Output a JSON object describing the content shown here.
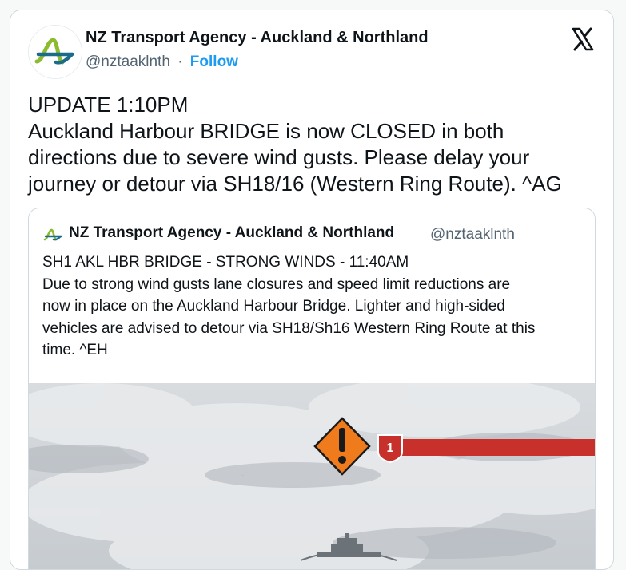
{
  "author": {
    "name": "NZ Transport Agency - Auckland & Northland",
    "handle": "@nztaaklnth",
    "separator": "·",
    "follow_label": "Follow",
    "avatar_icon": "nzta-logo-icon"
  },
  "platform_icon": "x-logo-icon",
  "tweet": {
    "lines": [
      "UPDATE 1:10PM",
      "Auckland Harbour BRIDGE is now CLOSED in both",
      "directions due to severe wind gusts. Please delay your",
      "journey or detour via SH18/16 (Western Ring Route). ^AG"
    ]
  },
  "quoted": {
    "name": "NZ Transport Agency - Auckland & Northland",
    "handle": "@nztaaklnth",
    "lines": [
      "SH1 AKL HBR BRIDGE - STRONG WINDS - 11:40AM",
      "Due to strong wind gusts lane closures and speed limit reductions are",
      "now in place on the Auckland Harbour Bridge. Lighter and high-sided",
      "vehicles are advised to detour via SH18/Sh16 Western Ring Route at this",
      "time. ^EH"
    ],
    "media": {
      "warning_icon": "warning-diamond-icon",
      "route_shield_label": "1",
      "colors": {
        "warning": "#f07b1d",
        "route": "#c8312b",
        "sky": "#cdd1d5"
      }
    }
  }
}
